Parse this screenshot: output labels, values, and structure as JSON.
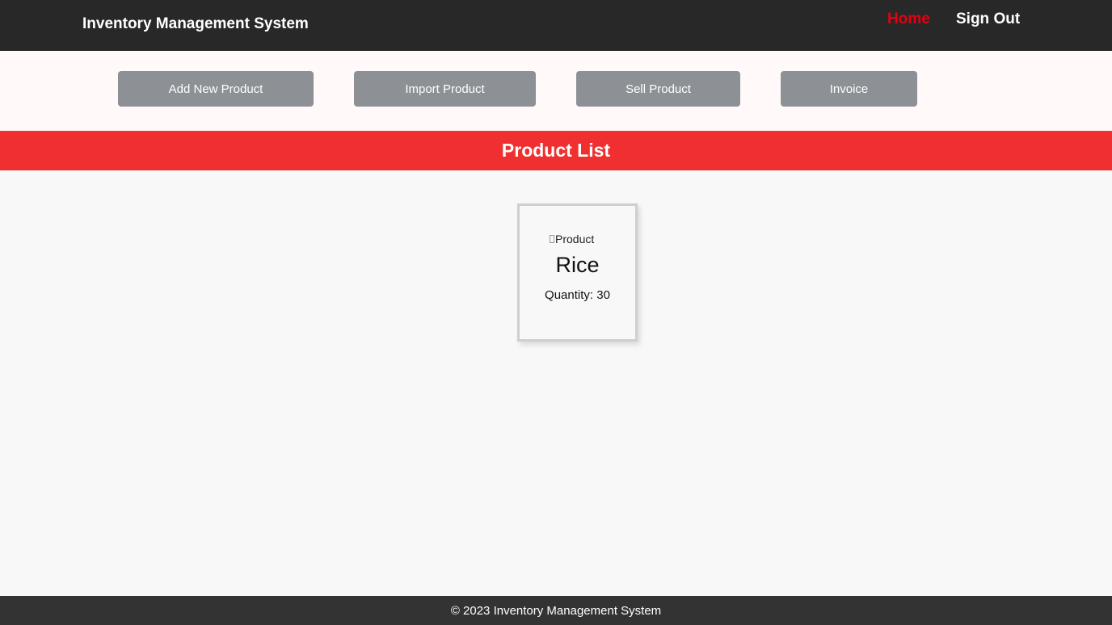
{
  "header": {
    "brand": "Inventory Management System",
    "nav": {
      "home": "Home",
      "sign_out": "Sign Out"
    },
    "active_color": "#e3000f"
  },
  "actions": {
    "add_new_product": "Add New Product",
    "import_product": "Import Product",
    "sell_product": "Sell Product",
    "invoice": "Invoice"
  },
  "section": {
    "title": "Product List",
    "accent": "#f03030"
  },
  "products": [
    {
      "image_alt": "Product",
      "name": "Rice",
      "quantity_text": "Quantity: 30"
    }
  ],
  "footer": {
    "text": "© 2023 Inventory Management System"
  }
}
